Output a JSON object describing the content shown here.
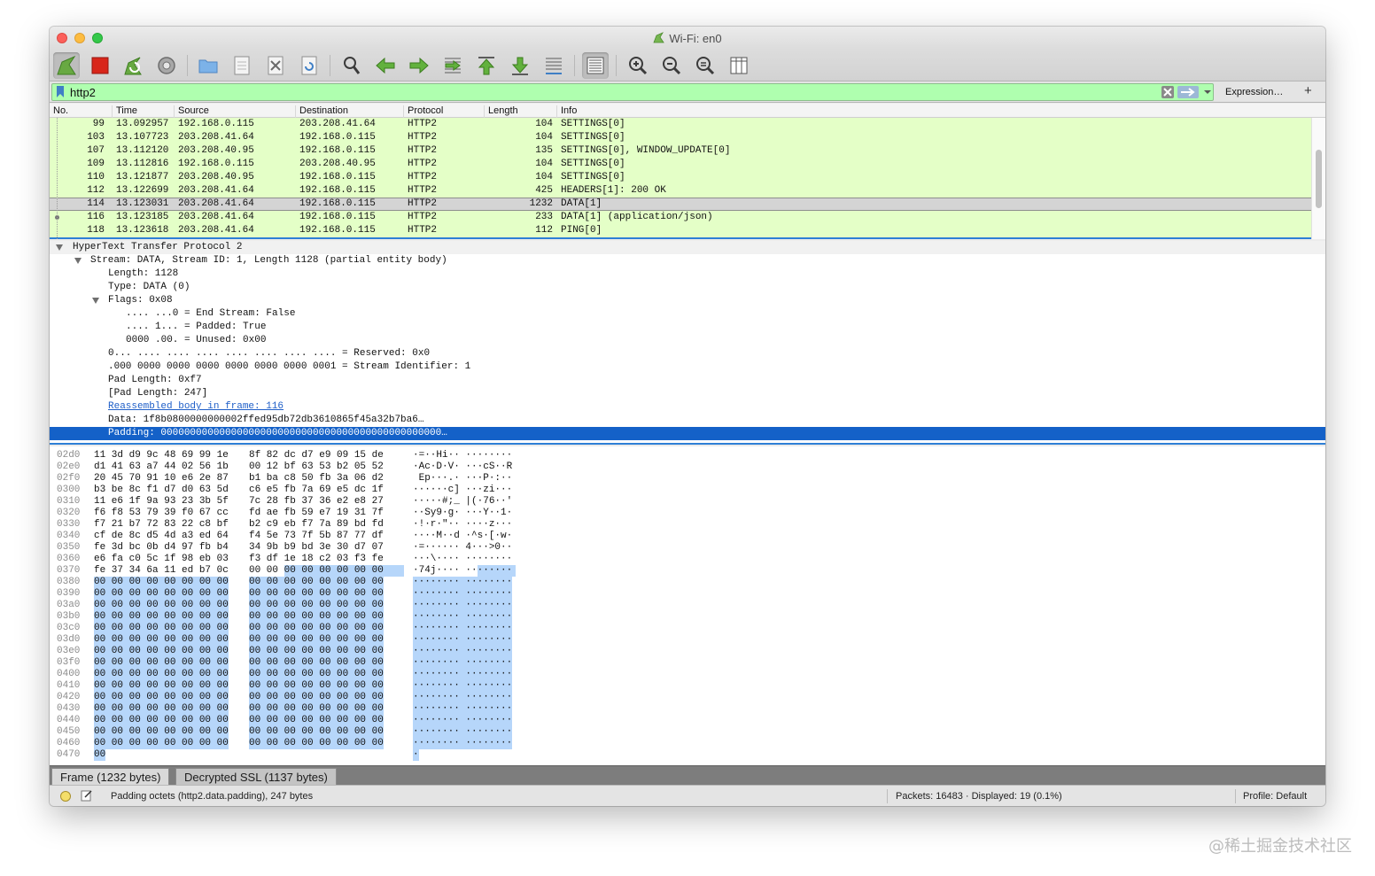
{
  "window": {
    "title": "Wi-Fi: en0"
  },
  "toolbar": {
    "buttons": [
      {
        "name": "start-capture",
        "icon": "shark-fin-icon"
      },
      {
        "name": "stop-capture",
        "icon": "stop-square-icon"
      },
      {
        "name": "restart-capture",
        "icon": "restart-icon"
      },
      {
        "name": "capture-options",
        "icon": "gear-icon"
      },
      {
        "name": "open-file",
        "icon": "folder-icon"
      },
      {
        "name": "save-file",
        "icon": "document-icon"
      },
      {
        "name": "close-file",
        "icon": "close-file-icon"
      },
      {
        "name": "reload-file",
        "icon": "reload-icon"
      },
      {
        "name": "find-packet",
        "icon": "search-icon"
      },
      {
        "name": "go-back",
        "icon": "arrow-left-icon"
      },
      {
        "name": "go-forward",
        "icon": "arrow-right-icon"
      },
      {
        "name": "go-to-packet",
        "icon": "jump-icon"
      },
      {
        "name": "go-first",
        "icon": "arrow-up-icon"
      },
      {
        "name": "go-last",
        "icon": "arrow-down-icon"
      },
      {
        "name": "auto-scroll",
        "icon": "auto-scroll-icon"
      },
      {
        "name": "colorize",
        "icon": "colorize-icon"
      },
      {
        "name": "zoom-in",
        "icon": "zoom-in-icon"
      },
      {
        "name": "zoom-out",
        "icon": "zoom-out-icon"
      },
      {
        "name": "normal-size",
        "icon": "zoom-reset-icon"
      },
      {
        "name": "resize-columns",
        "icon": "resize-columns-icon"
      }
    ]
  },
  "filter": {
    "value": "http2",
    "expression_label": "Expression…",
    "plus_label": "+"
  },
  "packet_list": {
    "columns": [
      "No.",
      "Time",
      "Source",
      "Destination",
      "Protocol",
      "Length",
      "Info"
    ],
    "rows": [
      {
        "no": "99",
        "time": "13.092957",
        "src": "192.168.0.115",
        "dst": "203.208.41.64",
        "proto": "HTTP2",
        "len": "104",
        "info": "SETTINGS[0]"
      },
      {
        "no": "103",
        "time": "13.107723",
        "src": "203.208.41.64",
        "dst": "192.168.0.115",
        "proto": "HTTP2",
        "len": "104",
        "info": "SETTINGS[0]"
      },
      {
        "no": "107",
        "time": "13.112120",
        "src": "203.208.40.95",
        "dst": "192.168.0.115",
        "proto": "HTTP2",
        "len": "135",
        "info": "SETTINGS[0], WINDOW_UPDATE[0]"
      },
      {
        "no": "109",
        "time": "13.112816",
        "src": "192.168.0.115",
        "dst": "203.208.40.95",
        "proto": "HTTP2",
        "len": "104",
        "info": "SETTINGS[0]"
      },
      {
        "no": "110",
        "time": "13.121877",
        "src": "203.208.40.95",
        "dst": "192.168.0.115",
        "proto": "HTTP2",
        "len": "104",
        "info": "SETTINGS[0]"
      },
      {
        "no": "112",
        "time": "13.122699",
        "src": "203.208.41.64",
        "dst": "192.168.0.115",
        "proto": "HTTP2",
        "len": "425",
        "info": "HEADERS[1]: 200 OK"
      },
      {
        "no": "114",
        "time": "13.123031",
        "src": "203.208.41.64",
        "dst": "192.168.0.115",
        "proto": "HTTP2",
        "len": "1232",
        "info": "DATA[1]"
      },
      {
        "no": "116",
        "time": "13.123185",
        "src": "203.208.41.64",
        "dst": "192.168.0.115",
        "proto": "HTTP2",
        "len": "233",
        "info": "DATA[1] (application/json)"
      },
      {
        "no": "118",
        "time": "13.123618",
        "src": "203.208.41.64",
        "dst": "192.168.0.115",
        "proto": "HTTP2",
        "len": "112",
        "info": "PING[0]"
      }
    ]
  },
  "details": {
    "lines": [
      "HyperText Transfer Protocol 2",
      "Stream: DATA, Stream ID: 1, Length 1128 (partial entity body)",
      "Length: 1128",
      "Type: DATA (0)",
      "Flags: 0x08",
      ".... ...0 = End Stream: False",
      ".... 1... = Padded: True",
      "0000 .00. = Unused: 0x00",
      "0... .... .... .... .... .... .... .... = Reserved: 0x0",
      ".000 0000 0000 0000 0000 0000 0000 0001 = Stream Identifier: 1",
      "Pad Length: 0xf7",
      "[Pad Length: 247]",
      "Reassembled body in frame: 116",
      "Data: 1f8b0800000000002ffed95db72db3610865f45a32b7ba6…",
      "Padding: 000000000000000000000000000000000000000000000000…"
    ]
  },
  "hex": {
    "rows": [
      {
        "off": "02d0",
        "b1": "11 3d d9 9c 48 69 99 1e",
        "b2": "8f 82 dc d7 e9 09 15 de",
        "asc": "·=··Hi·· ········"
      },
      {
        "off": "02e0",
        "b1": "d1 41 63 a7 44 02 56 1b",
        "b2": "00 12 bf 63 53 b2 05 52",
        "asc": "·Ac·D·V· ···cS··R"
      },
      {
        "off": "02f0",
        "b1": "20 45 70 91 10 e6 2e 87",
        "b2": "b1 ba c8 50 fb 3a 06 d2",
        "asc": " Ep···.· ···P·:··"
      },
      {
        "off": "0300",
        "b1": "b3 be 8c f1 d7 d0 63 5d",
        "b2": "c6 e5 fb 7a 69 e5 dc 1f",
        "asc": "······c] ···zi···"
      },
      {
        "off": "0310",
        "b1": "11 e6 1f 9a 93 23 3b 5f",
        "b2": "7c 28 fb 37 36 e2 e8 27",
        "asc": "·····#;_ |(·76··'"
      },
      {
        "off": "0320",
        "b1": "f6 f8 53 79 39 f0 67 cc",
        "b2": "fd ae fb 59 e7 19 31 7f",
        "asc": "··Sy9·g· ···Y··1·"
      },
      {
        "off": "0330",
        "b1": "f7 21 b7 72 83 22 c8 bf",
        "b2": "b2 c9 eb f7 7a 89 bd fd",
        "asc": "·!·r·\"·· ····z···"
      },
      {
        "off": "0340",
        "b1": "cf de 8c d5 4d a3 ed 64",
        "b2": "f4 5e 73 7f 5b 87 77 df",
        "asc": "····M··d ·^s·[·w·"
      },
      {
        "off": "0350",
        "b1": "fe 3d bc 0b d4 97 fb b4",
        "b2": "34 9b b9 bd 3e 30 d7 07",
        "asc": "·=······ 4···>0··"
      },
      {
        "off": "0360",
        "b1": "e6 fa c0 5c 1f 98 eb 03",
        "b2": "f3 df 1e 18 c2 03 f3 fe",
        "asc": "···\\···· ········"
      },
      {
        "off": "0370",
        "b1": "fe 37 34 6a 11 ed b7 0c",
        "b2": "00 00 00 00 00 00 00 00",
        "asc": "·74j···· ········",
        "hl_from_b2_byte": 2
      },
      {
        "off": "0380",
        "b1": "00 00 00 00 00 00 00 00",
        "b2": "00 00 00 00 00 00 00 00",
        "asc": "········ ········",
        "hl": true
      },
      {
        "off": "0390",
        "b1": "00 00 00 00 00 00 00 00",
        "b2": "00 00 00 00 00 00 00 00",
        "asc": "········ ········",
        "hl": true
      },
      {
        "off": "03a0",
        "b1": "00 00 00 00 00 00 00 00",
        "b2": "00 00 00 00 00 00 00 00",
        "asc": "········ ········",
        "hl": true
      },
      {
        "off": "03b0",
        "b1": "00 00 00 00 00 00 00 00",
        "b2": "00 00 00 00 00 00 00 00",
        "asc": "········ ········",
        "hl": true
      },
      {
        "off": "03c0",
        "b1": "00 00 00 00 00 00 00 00",
        "b2": "00 00 00 00 00 00 00 00",
        "asc": "········ ········",
        "hl": true
      },
      {
        "off": "03d0",
        "b1": "00 00 00 00 00 00 00 00",
        "b2": "00 00 00 00 00 00 00 00",
        "asc": "········ ········",
        "hl": true
      },
      {
        "off": "03e0",
        "b1": "00 00 00 00 00 00 00 00",
        "b2": "00 00 00 00 00 00 00 00",
        "asc": "········ ········",
        "hl": true
      },
      {
        "off": "03f0",
        "b1": "00 00 00 00 00 00 00 00",
        "b2": "00 00 00 00 00 00 00 00",
        "asc": "········ ········",
        "hl": true
      },
      {
        "off": "0400",
        "b1": "00 00 00 00 00 00 00 00",
        "b2": "00 00 00 00 00 00 00 00",
        "asc": "········ ········",
        "hl": true
      },
      {
        "off": "0410",
        "b1": "00 00 00 00 00 00 00 00",
        "b2": "00 00 00 00 00 00 00 00",
        "asc": "········ ········",
        "hl": true
      },
      {
        "off": "0420",
        "b1": "00 00 00 00 00 00 00 00",
        "b2": "00 00 00 00 00 00 00 00",
        "asc": "········ ········",
        "hl": true
      },
      {
        "off": "0430",
        "b1": "00 00 00 00 00 00 00 00",
        "b2": "00 00 00 00 00 00 00 00",
        "asc": "········ ········",
        "hl": true
      },
      {
        "off": "0440",
        "b1": "00 00 00 00 00 00 00 00",
        "b2": "00 00 00 00 00 00 00 00",
        "asc": "········ ········",
        "hl": true
      },
      {
        "off": "0450",
        "b1": "00 00 00 00 00 00 00 00",
        "b2": "00 00 00 00 00 00 00 00",
        "asc": "········ ········",
        "hl": true
      },
      {
        "off": "0460",
        "b1": "00 00 00 00 00 00 00 00",
        "b2": "00 00 00 00 00 00 00 00",
        "asc": "········ ········",
        "hl": true
      },
      {
        "off": "0470",
        "b1": "00",
        "b2": "",
        "asc": "·",
        "hl": true
      }
    ]
  },
  "bytes_tabs": [
    "Frame (1232 bytes)",
    "Decrypted SSL (1137 bytes)"
  ],
  "status": {
    "message": "Padding octets (http2.data.padding), 247 bytes",
    "packets": "Packets: 16483 · Displayed: 19 (0.1%)",
    "profile": "Profile: Default"
  },
  "watermark": "@稀土掘金技术社区",
  "colors": {
    "filter_ok": "#afffaf",
    "row_http2": "#e4ffc7",
    "selection": "#1461c8",
    "hex_highlight": "#b6d6fa"
  }
}
